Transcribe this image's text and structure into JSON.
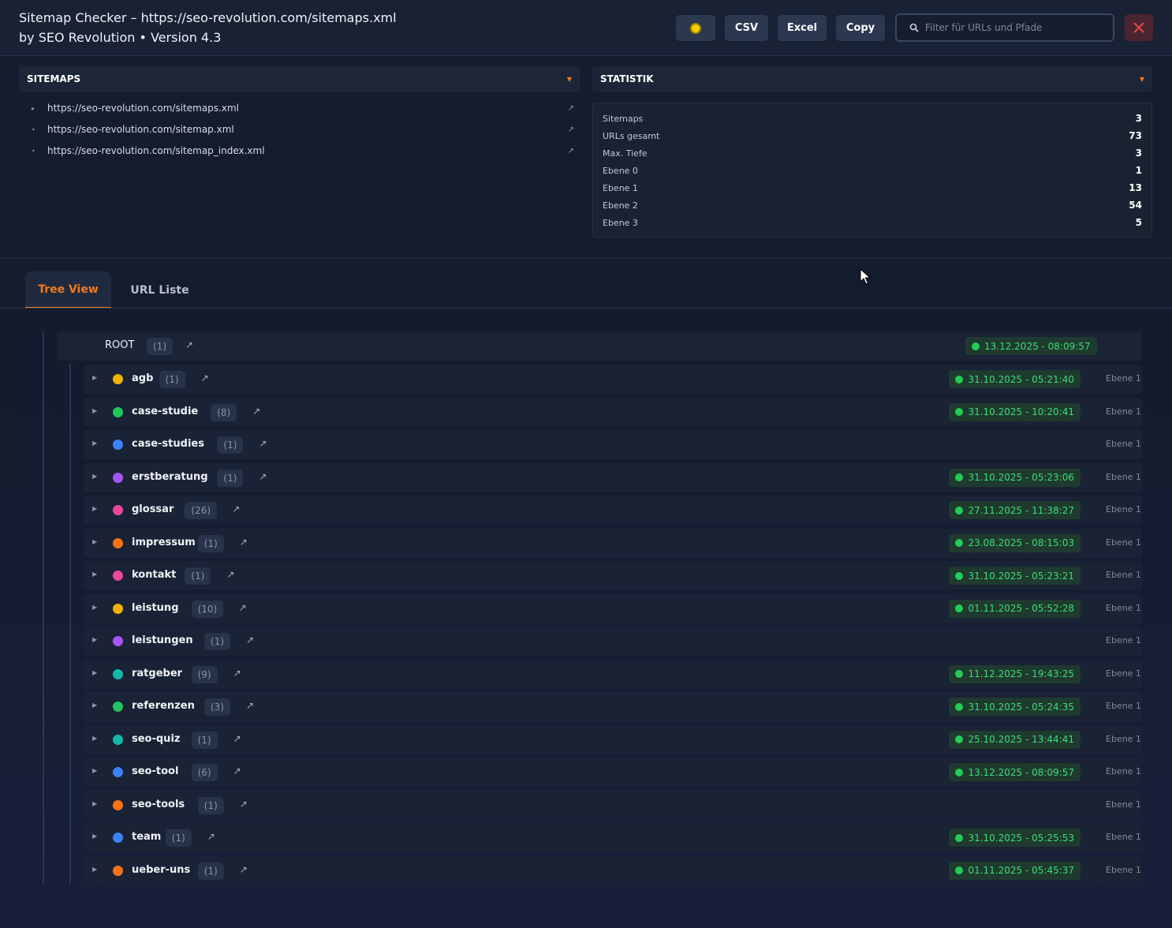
{
  "header": {
    "title_line1": "Sitemap Checker – https://seo-revolution.com/sitemaps.xml",
    "title_line2": "by SEO Revolution • Version 4.3",
    "buttons": {
      "theme_icon": "sun-icon",
      "csv": "CSV",
      "excel": "Excel",
      "copy": "Copy"
    },
    "search_placeholder": "Filter für URLs und Pfade",
    "search_icon": "magnifier-icon",
    "close_icon": "close-icon",
    "colors": {
      "accent": "#f07a20",
      "close": "#e04848",
      "date_green": "#3ddc7a"
    }
  },
  "sitemaps": {
    "heading": "SITEMAPS",
    "items": [
      {
        "bullet": "▸",
        "url": "https://seo-revolution.com/sitemaps.xml"
      },
      {
        "bullet": "•",
        "url": "https://seo-revolution.com/sitemap.xml"
      },
      {
        "bullet": "•",
        "url": "https://seo-revolution.com/sitemap_index.xml"
      }
    ]
  },
  "statistik": {
    "heading": "STATISTIK",
    "rows": [
      {
        "label": "Sitemaps",
        "value": "3"
      },
      {
        "label": "URLs gesamt",
        "value": "73"
      },
      {
        "label": "Max. Tiefe",
        "value": "3"
      },
      {
        "label": "Ebene 0",
        "value": "1"
      },
      {
        "label": "Ebene 1",
        "value": "13"
      },
      {
        "label": "Ebene 2",
        "value": "54"
      },
      {
        "label": "Ebene 3",
        "value": "5"
      }
    ]
  },
  "tabs": [
    {
      "label": "Tree View",
      "active": true
    },
    {
      "label": "URL Liste",
      "active": false
    }
  ],
  "tree": {
    "root": {
      "name": "ROOT",
      "count": "(1)",
      "date": "13.12.2025 - 08:09:57"
    },
    "nodes": [
      {
        "name": "agb",
        "count": "(1)",
        "color": "#f0b400",
        "date": "31.10.2025 - 05:21:40",
        "level": "Ebene 1"
      },
      {
        "name": "case-studie",
        "count": "(8)",
        "color": "#22c55e",
        "date": "31.10.2025 - 10:20:41",
        "level": "Ebene 1"
      },
      {
        "name": "case-studies",
        "count": "(1)",
        "color": "#3b82f6",
        "date": "",
        "level": "Ebene 1"
      },
      {
        "name": "erstberatung",
        "count": "(1)",
        "color": "#a855f7",
        "date": "31.10.2025 - 05:23:06",
        "level": "Ebene 1"
      },
      {
        "name": "glossar",
        "count": "(26)",
        "color": "#ec4899",
        "date": "27.11.2025 - 11:38:27",
        "level": "Ebene 1"
      },
      {
        "name": "impressum",
        "count": "(1)",
        "color": "#f97316",
        "date": "23.08.2025 - 08:15:03",
        "level": "Ebene 1"
      },
      {
        "name": "kontakt",
        "count": "(1)",
        "color": "#ec4899",
        "date": "31.10.2025 - 05:23:21",
        "level": "Ebene 1"
      },
      {
        "name": "leistung",
        "count": "(10)",
        "color": "#f0b400",
        "date": "01.11.2025 - 05:52:28",
        "level": "Ebene 1"
      },
      {
        "name": "leistungen",
        "count": "(1)",
        "color": "#a855f7",
        "date": "",
        "level": "Ebene 1"
      },
      {
        "name": "ratgeber",
        "count": "(9)",
        "color": "#14b8a6",
        "date": "11.12.2025 - 19:43:25",
        "level": "Ebene 1"
      },
      {
        "name": "referenzen",
        "count": "(3)",
        "color": "#22c55e",
        "date": "31.10.2025 - 05:24:35",
        "level": "Ebene 1"
      },
      {
        "name": "seo-quiz",
        "count": "(1)",
        "color": "#14b8a6",
        "date": "25.10.2025 - 13:44:41",
        "level": "Ebene 1"
      },
      {
        "name": "seo-tool",
        "count": "(6)",
        "color": "#3b82f6",
        "date": "13.12.2025 - 08:09:57",
        "level": "Ebene 1"
      },
      {
        "name": "seo-tools",
        "count": "(1)",
        "color": "#f97316",
        "date": "",
        "level": "Ebene 1"
      },
      {
        "name": "team",
        "count": "(1)",
        "color": "#3b82f6",
        "date": "31.10.2025 - 05:25:53",
        "level": "Ebene 1"
      },
      {
        "name": "ueber-uns",
        "count": "(1)",
        "color": "#f97316",
        "date": "01.11.2025 - 05:45:37",
        "level": "Ebene 1"
      }
    ]
  }
}
